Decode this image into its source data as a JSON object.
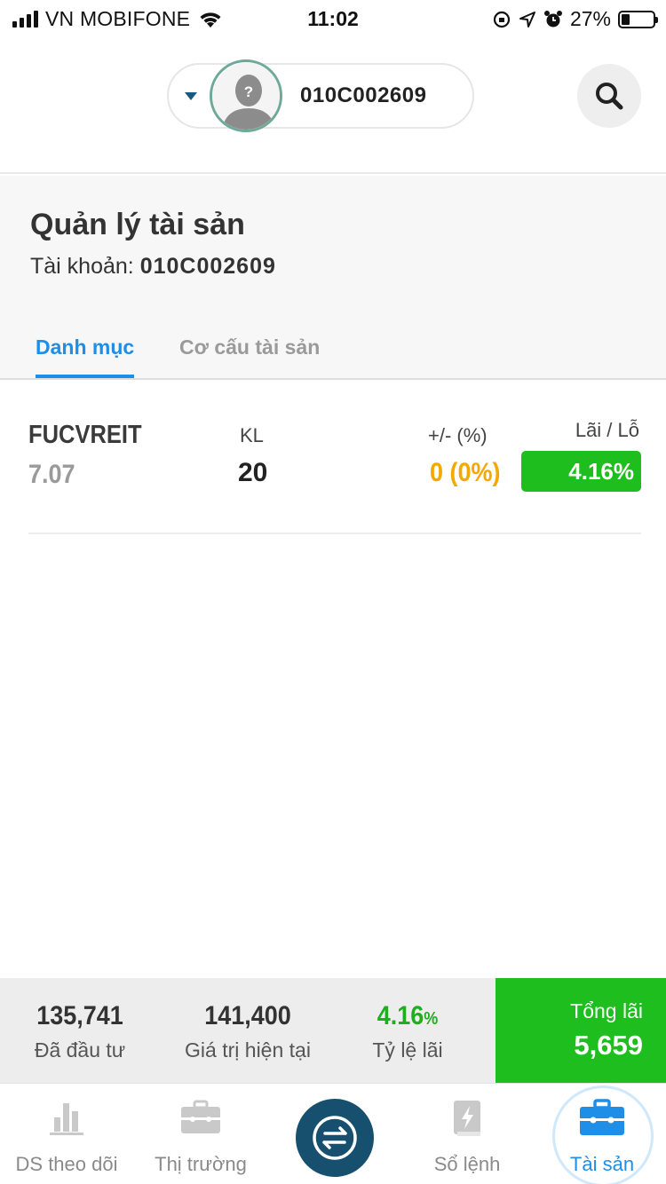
{
  "status_bar": {
    "carrier": "VN MOBIFONE",
    "time": "11:02",
    "battery_percent": "27%",
    "battery_level": 0.27
  },
  "header": {
    "account_id": "010C002609",
    "avatar_glyph": "?"
  },
  "page": {
    "title": "Quản lý tài sản",
    "account_label": "Tài khoản:",
    "account_value": "010C002609",
    "tabs": [
      {
        "label": "Danh mục",
        "active": true
      },
      {
        "label": "Cơ cấu tài sản",
        "active": false
      }
    ]
  },
  "holdings": [
    {
      "symbol": "FUCVREIT",
      "price": "7.07",
      "kl_label": "KL",
      "kl_value": "20",
      "change_label": "+/- (%)",
      "change_value": "0 (0%)",
      "pl_label": "Lãi / Lỗ",
      "pl_value": "4.16%"
    }
  ],
  "summary": {
    "invested_value": "135,741",
    "invested_label": "Đã đầu tư",
    "current_value": "141,400",
    "current_label": "Giá trị hiện tại",
    "profit_rate_number": "4.16",
    "profit_rate_unit": "%",
    "profit_rate_label": "Tỷ lệ lãi",
    "total_profit_label": "Tổng lãi",
    "total_profit_value": "5,659"
  },
  "nav": {
    "items": [
      {
        "label": "DS theo dõi",
        "icon": "bar-chart-icon"
      },
      {
        "label": "Thị trường",
        "icon": "briefcase-icon"
      },
      {
        "label": "",
        "icon": "exchange-icon"
      },
      {
        "label": "Sổ lệnh",
        "icon": "order-book-icon"
      },
      {
        "label": "Tài sản",
        "icon": "briefcase-icon",
        "active": true
      }
    ]
  },
  "colors": {
    "accent_blue": "#1e8ee6",
    "profit_green": "#1fbe1f",
    "neutral_orange": "#f5a800",
    "nav_center": "#17506f"
  }
}
